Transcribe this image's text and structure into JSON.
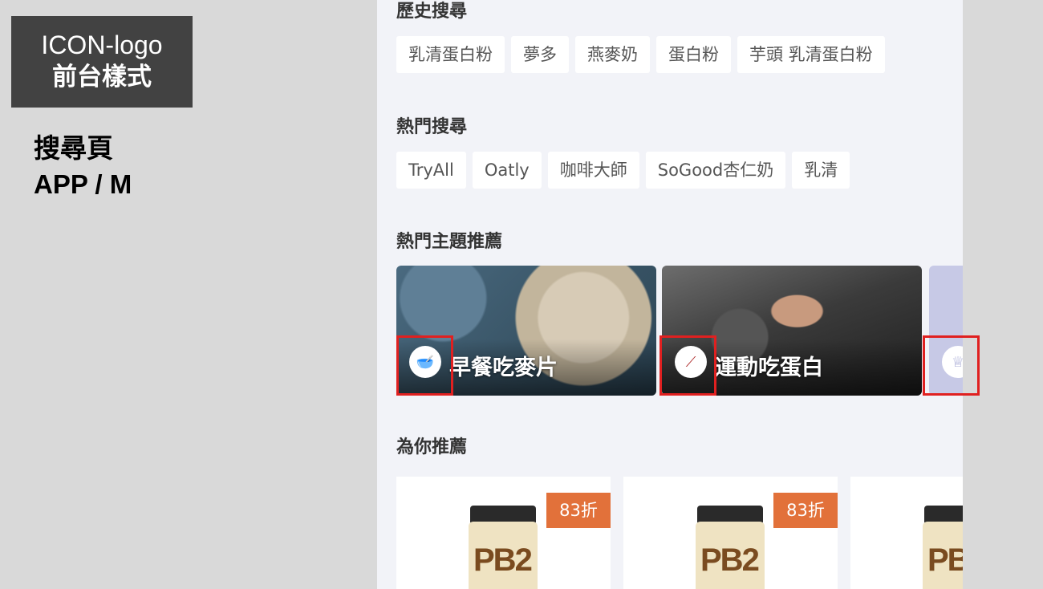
{
  "annotation": {
    "title_line1": "ICON-logo",
    "title_line2": "前台樣式",
    "page_name": "搜尋頁",
    "platform": "APP / M"
  },
  "history": {
    "title": "歷史搜尋",
    "items": [
      "乳清蛋白粉",
      "夢多",
      "燕麥奶",
      "蛋白粉",
      "芋頭 乳清蛋白粉"
    ]
  },
  "hot": {
    "title": "熱門搜尋",
    "items": [
      "TryAll",
      "Oatly",
      "咖啡大師",
      "SoGood杏仁奶",
      "乳清"
    ]
  },
  "topics": {
    "title": "熱門主題推薦",
    "items": [
      {
        "label": "早餐吃麥片",
        "icon": "cereal-bowl-icon",
        "glyph": "🥣"
      },
      {
        "label": "運動吃蛋白",
        "icon": "dumbbell-icon",
        "glyph": "⟋"
      },
      {
        "label": "",
        "icon": "cup-icon",
        "glyph": "♕"
      }
    ]
  },
  "recommend": {
    "title": "為你推薦",
    "products": [
      {
        "discount": "83折",
        "brand": "PB2"
      },
      {
        "discount": "83折",
        "brand": "PB2"
      },
      {
        "discount": "",
        "brand": "PB"
      }
    ]
  },
  "colors": {
    "highlight": "#e02020",
    "discount": "#e2713a",
    "phone_bg": "#f2f3f8"
  }
}
